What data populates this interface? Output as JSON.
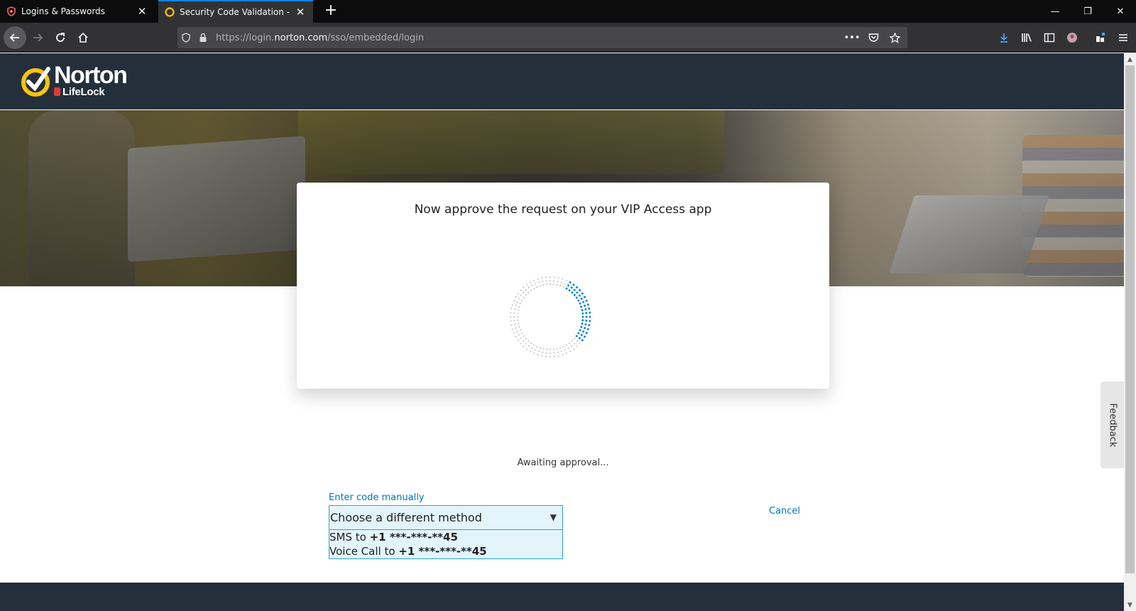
{
  "browser": {
    "tabs": [
      {
        "title": "Logins & Passwords",
        "icon": "lockwise-icon",
        "active": false
      },
      {
        "title": "Security Code Validation - Offic",
        "icon": "norton-icon",
        "active": true
      }
    ],
    "new_tab_label": "+",
    "window_controls": {
      "minimize": "—",
      "restore": "❐",
      "close": "✕"
    },
    "url": {
      "prefix": "https://login.",
      "host": "norton.com",
      "path": "/sso/embedded/login"
    },
    "accent_color": "#0a84ff"
  },
  "site": {
    "logo": {
      "word": "Norton",
      "sub": "LifeLock"
    },
    "brand_yellow": "#ffc20e",
    "header_color": "#242f3c"
  },
  "card": {
    "title": "Now approve the request on your VIP Access app"
  },
  "status": {
    "text": "Awaiting approval..."
  },
  "links": {
    "enter_code": "Enter code manually",
    "cancel": "Cancel"
  },
  "method_select": {
    "placeholder": "Choose a different method",
    "options": [
      {
        "prefix": "SMS to ",
        "number": "+1 ***-***-**45"
      },
      {
        "prefix": "Voice Call to ",
        "number": "+1 ***-***-**45"
      }
    ]
  },
  "feedback": {
    "label": "Feedback"
  },
  "link_color": "#0075b0",
  "spinner_color": "#0a87c8"
}
